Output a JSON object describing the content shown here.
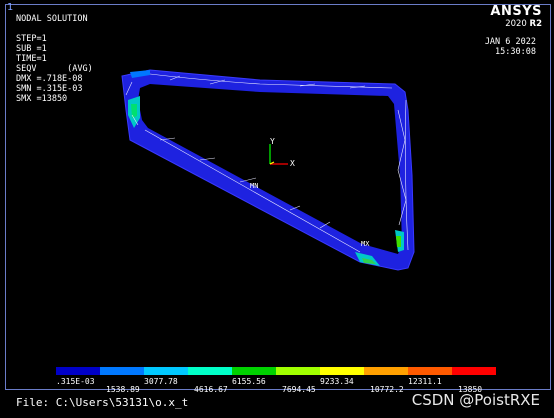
{
  "window_number": "1",
  "title": "NODAL SOLUTION",
  "info_lines": [
    "STEP=1",
    "SUB =1",
    "TIME=1",
    "SEQV      (AVG)",
    "DMX =.718E-08",
    "SMN =.315E-03",
    "SMX =13850"
  ],
  "brand": {
    "name": "ANSYS",
    "version": "2020",
    "release": "R2"
  },
  "date": "JAN  6 2022",
  "time": "15:30:08",
  "triad": {
    "y_label": "Y",
    "x_label": "X"
  },
  "markers": {
    "min": "MN",
    "max": "MX"
  },
  "legend": {
    "colors": [
      "#0000c8",
      "#0078ff",
      "#00c8ff",
      "#00ffc8",
      "#00d200",
      "#a0ff00",
      "#ffff00",
      "#ffa000",
      "#ff5a00",
      "#ff0000"
    ],
    "labels_top": [
      ".315E-03",
      "3077.78",
      "6155.56",
      "9233.34",
      "12311.1"
    ],
    "labels_bottom": [
      "1538.89",
      "4616.67",
      "7694.45",
      "10772.2",
      "13850"
    ]
  },
  "file_line": "File: C:\\Users\\53131\\o.x_t",
  "watermark": "CSDN @PoistRXE"
}
